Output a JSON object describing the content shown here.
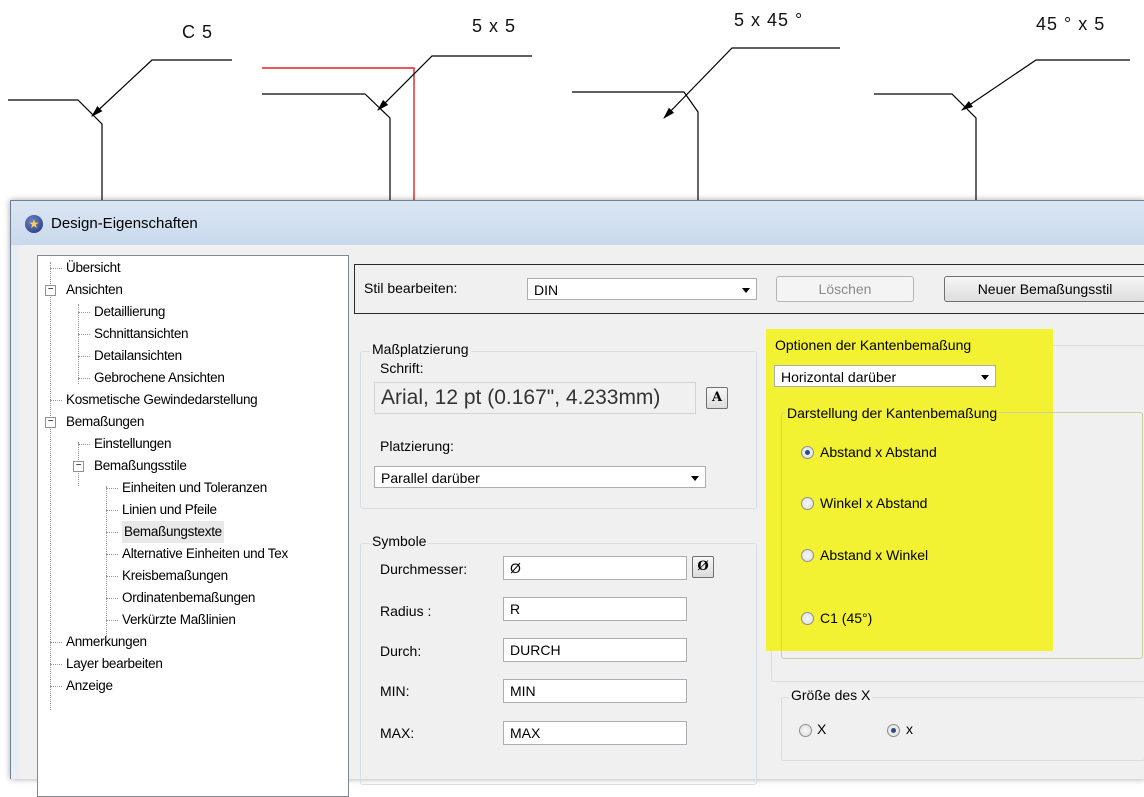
{
  "drawing": {
    "labels": [
      "C 5",
      "5 x 5",
      "5 x 45 °",
      "45 ° x 5"
    ]
  },
  "dialog": {
    "title": "Design-Eigenschaften",
    "tree": [
      "Übersicht",
      "Ansichten",
      "Detaillierung",
      "Schnittansichten",
      "Detailansichten",
      "Gebrochene Ansichten",
      "Kosmetische Gewindedarstellung",
      "Bemaßungen",
      "Einstellungen",
      "Bemaßungsstile",
      "Einheiten und Toleranzen",
      "Linien und Pfeile",
      "Bemaßungstexte",
      "Alternative Einheiten und Tex",
      "Kreisbemaßungen",
      "Ordinatenbemaßungen",
      "Verkürzte Maßlinien",
      "Anmerkungen",
      "Layer bearbeiten",
      "Anzeige"
    ],
    "style_bar": {
      "label": "Stil bearbeiten:",
      "value": "DIN",
      "delete_button": "Löschen",
      "new_button": "Neuer Bemaßungsstil"
    },
    "placement": {
      "group_title": "Maßplatzierung",
      "font_label": "Schrift:",
      "font_value": "Arial, 12 pt (0.167\", 4.233mm)",
      "font_button": "A",
      "placement_label": "Platzierung:",
      "placement_value": "Parallel darüber"
    },
    "symbols": {
      "group_title": "Symbole",
      "diameter_label": "Durchmesser:",
      "diameter_value": "Ø",
      "diameter_button": "Ø",
      "radius_label": "Radius :",
      "radius_value": "R",
      "through_label": "Durch:",
      "through_value": "DURCH",
      "min_label": "MIN:",
      "min_value": "MIN",
      "max_label": "MAX:",
      "max_value": "MAX"
    },
    "edge_options": {
      "group_title": "Optionen der Kantenbemaßung",
      "select_value": "Horizontal darüber",
      "display_group_title": "Darstellung der Kantenbemaßung",
      "radios": [
        "Abstand x Abstand",
        "Winkel x Abstand",
        "Abstand x Winkel",
        "C1 (45°)"
      ],
      "selected_index": 0
    },
    "x_size": {
      "group_title": "Größe des X",
      "option_upper": "X",
      "option_lower": "x",
      "selected": "x"
    },
    "highlight_color": "#f2f233"
  }
}
